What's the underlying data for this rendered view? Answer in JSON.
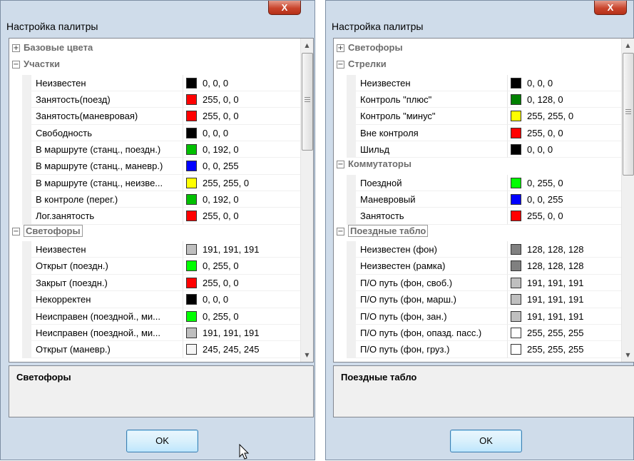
{
  "left": {
    "title": "Настройка палитры",
    "close_glyph": "X",
    "rows": [
      {
        "type": "category",
        "expander": "+",
        "label": "Базовые цвета"
      },
      {
        "type": "category",
        "expander": "−",
        "label": "Участки"
      },
      {
        "type": "item",
        "name": "Неизвестен",
        "value": "0, 0, 0",
        "color": "#000000"
      },
      {
        "type": "item",
        "name": "Занятость(поезд)",
        "value": "255, 0, 0",
        "color": "#ff0000"
      },
      {
        "type": "item",
        "name": "Занятость(маневровая)",
        "value": "255, 0, 0",
        "color": "#ff0000"
      },
      {
        "type": "item",
        "name": "Свободность",
        "value": "0, 0, 0",
        "color": "#000000"
      },
      {
        "type": "item",
        "name": "В маршруте (станц., поездн.)",
        "value": "0, 192, 0",
        "color": "#00c000"
      },
      {
        "type": "item",
        "name": "В маршруте (станц., маневр.)",
        "value": "0, 0, 255",
        "color": "#0000ff"
      },
      {
        "type": "item",
        "name": "В маршруте (станц., неизве...",
        "value": "255, 255, 0",
        "color": "#ffff00"
      },
      {
        "type": "item",
        "name": "В контроле (перег.)",
        "value": "0, 192, 0",
        "color": "#00c000"
      },
      {
        "type": "item",
        "name": "Лог.занятость",
        "value": "255, 0, 0",
        "color": "#ff0000"
      },
      {
        "type": "category",
        "expander": "−",
        "label": "Светофоры",
        "selected": true
      },
      {
        "type": "item",
        "name": "Неизвестен",
        "value": "191, 191, 191",
        "color": "#bfbfbf"
      },
      {
        "type": "item",
        "name": "Открыт (поездн.)",
        "value": "0, 255, 0",
        "color": "#00ff00"
      },
      {
        "type": "item",
        "name": "Закрыт (поездн.)",
        "value": "255, 0, 0",
        "color": "#ff0000"
      },
      {
        "type": "item",
        "name": "Некорректен",
        "value": "0, 0, 0",
        "color": "#000000"
      },
      {
        "type": "item",
        "name": "Неисправен (поездной., ми...",
        "value": "0, 255, 0",
        "color": "#00ff00"
      },
      {
        "type": "item",
        "name": "Неисправен (поездной., ми...",
        "value": "191, 191, 191",
        "color": "#bfbfbf"
      },
      {
        "type": "item",
        "name": "Открыт (маневр.)",
        "value": "245, 245, 245",
        "color": "#f5f5f5"
      }
    ],
    "description": "Светофоры",
    "ok_label": "OK"
  },
  "right": {
    "title": "Настройка палитры",
    "close_glyph": "X",
    "rows": [
      {
        "type": "category",
        "expander": "+",
        "label": "Светофоры"
      },
      {
        "type": "category",
        "expander": "−",
        "label": "Стрелки"
      },
      {
        "type": "item",
        "name": "Неизвестен",
        "value": "0, 0, 0",
        "color": "#000000"
      },
      {
        "type": "item",
        "name": "Контроль \"плюс\"",
        "value": "0, 128, 0",
        "color": "#008000"
      },
      {
        "type": "item",
        "name": "Контроль \"минус\"",
        "value": "255, 255, 0",
        "color": "#ffff00"
      },
      {
        "type": "item",
        "name": "Вне контроля",
        "value": "255, 0, 0",
        "color": "#ff0000"
      },
      {
        "type": "item",
        "name": "Шильд",
        "value": "0, 0, 0",
        "color": "#000000"
      },
      {
        "type": "category",
        "expander": "−",
        "label": "Коммутаторы"
      },
      {
        "type": "item",
        "name": "Поездной",
        "value": "0, 255, 0",
        "color": "#00ff00"
      },
      {
        "type": "item",
        "name": "Маневровый",
        "value": "0, 0, 255",
        "color": "#0000ff"
      },
      {
        "type": "item",
        "name": "Занятость",
        "value": "255, 0, 0",
        "color": "#ff0000"
      },
      {
        "type": "category",
        "expander": "−",
        "label": "Поездные табло",
        "selected": true
      },
      {
        "type": "item",
        "name": "Неизвестен (фон)",
        "value": "128, 128, 128",
        "color": "#808080"
      },
      {
        "type": "item",
        "name": "Неизвестен (рамка)",
        "value": "128, 128, 128",
        "color": "#808080"
      },
      {
        "type": "item",
        "name": "П/О путь (фон, своб.)",
        "value": "191, 191, 191",
        "color": "#bfbfbf"
      },
      {
        "type": "item",
        "name": "П/О путь (фон, марш.)",
        "value": "191, 191, 191",
        "color": "#bfbfbf"
      },
      {
        "type": "item",
        "name": "П/О путь (фон, зан.)",
        "value": "191, 191, 191",
        "color": "#bfbfbf"
      },
      {
        "type": "item",
        "name": "П/О путь (фон, опазд. пасс.)",
        "value": "255, 255, 255",
        "color": "#ffffff"
      },
      {
        "type": "item",
        "name": "П/О путь (фон, груз.)",
        "value": "255, 255, 255",
        "color": "#ffffff"
      }
    ],
    "description": "Поездные табло",
    "ok_label": "OK"
  },
  "scroll_icons": {
    "up": "▲",
    "down": "▼"
  }
}
